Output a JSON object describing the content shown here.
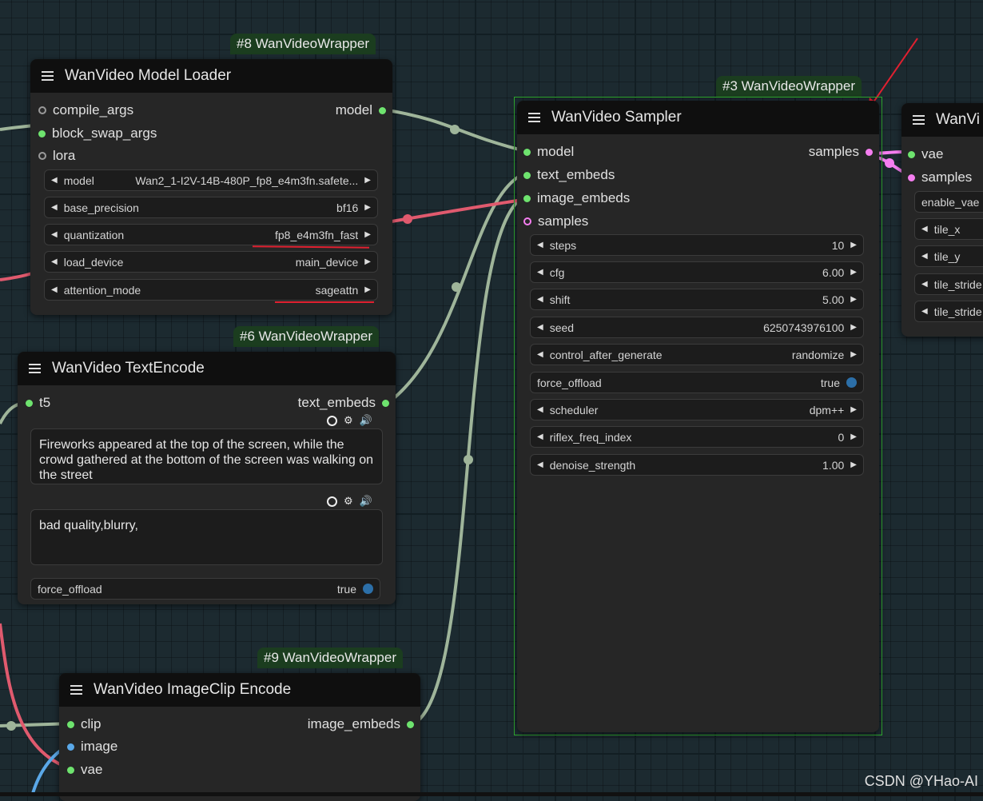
{
  "nodes": {
    "model_loader": {
      "badge": "#8 WanVideoWrapper",
      "title": "WanVideo Model Loader",
      "inputs": [
        "compile_args",
        "block_swap_args",
        "lora"
      ],
      "output": "model",
      "widgets": [
        {
          "name": "model",
          "value": "Wan2_1-I2V-14B-480P_fp8_e4m3fn.safete..."
        },
        {
          "name": "base_precision",
          "value": "bf16"
        },
        {
          "name": "quantization",
          "value": "fp8_e4m3fn_fast"
        },
        {
          "name": "load_device",
          "value": "main_device"
        },
        {
          "name": "attention_mode",
          "value": "sageattn"
        }
      ]
    },
    "text_encode": {
      "badge": "#6 WanVideoWrapper",
      "title": "WanVideo TextEncode",
      "input": "t5",
      "output": "text_embeds",
      "positive_prompt": "Fireworks appeared at the top of the screen, while the crowd gathered at the bottom of the screen was walking on the street",
      "negative_prompt": "bad quality,blurry,",
      "force_offload": {
        "name": "force_offload",
        "value": "true"
      }
    },
    "imageclip_encode": {
      "badge": "#9 WanVideoWrapper",
      "title": "WanVideo ImageClip Encode",
      "inputs": [
        "clip",
        "image",
        "vae"
      ],
      "output": "image_embeds"
    },
    "sampler": {
      "badge": "#3 WanVideoWrapper",
      "title": "WanVideo Sampler",
      "inputs": [
        "model",
        "text_embeds",
        "image_embeds",
        "samples"
      ],
      "output": "samples",
      "widgets": [
        {
          "name": "steps",
          "value": "10"
        },
        {
          "name": "cfg",
          "value": "6.00"
        },
        {
          "name": "shift",
          "value": "5.00"
        },
        {
          "name": "seed",
          "value": "6250743976100"
        },
        {
          "name": "control_after_generate",
          "value": "randomize"
        },
        {
          "name": "force_offload",
          "value": "true"
        },
        {
          "name": "scheduler",
          "value": "dpm++"
        },
        {
          "name": "riflex_freq_index",
          "value": "0"
        },
        {
          "name": "denoise_strength",
          "value": "1.00"
        }
      ]
    },
    "decode": {
      "title": "WanVi",
      "inputs": [
        "vae",
        "samples"
      ],
      "widgets": [
        "enable_vae",
        "tile_x",
        "tile_y",
        "tile_stride",
        "tile_stride"
      ]
    }
  },
  "watermark": "CSDN @YHao-AI",
  "colors": {
    "model_wire": "#9fb59a",
    "vae_wire": "#e05a6e",
    "latent_wire": "#f57ef0",
    "image_wire": "#5aa8e8",
    "annotation": "#e02030",
    "selection": "#2fa82f"
  }
}
